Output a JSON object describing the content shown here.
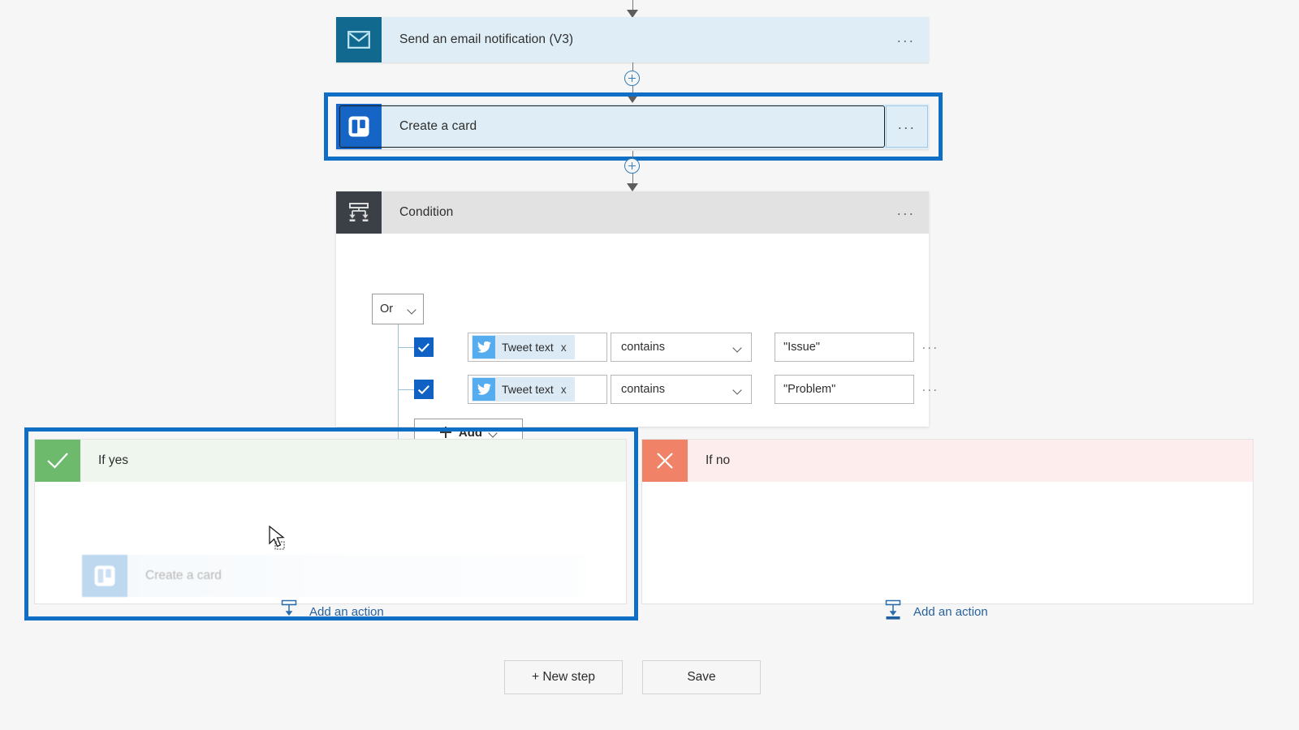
{
  "colors": {
    "canvas_bg": "#f6f6f6",
    "card_bg": "#dfeef6",
    "selection_blue": "#0f6fc5",
    "email_icon_bg": "#11698f",
    "trello_icon_bg": "#1565c6",
    "condition_icon_bg": "#3b3f46",
    "condition_header_bg": "#e2e2e2",
    "checkbox_blue": "#0f62c4",
    "twitter_blue": "#55acee",
    "yes_badge_green": "#6dba6d",
    "yes_header_bg": "#eef6ee",
    "no_badge_red": "#f08268",
    "no_header_bg": "#fdeeed",
    "link_blue": "#28629e",
    "tree_line": "#9cc4d6"
  },
  "steps": {
    "send_email": {
      "title": "Send an email notification (V3)",
      "icon": "envelope-icon",
      "menu": "..."
    },
    "create_card": {
      "title": "Create a card",
      "icon": "trello-icon",
      "menu": "...",
      "selected": true
    },
    "condition": {
      "title": "Condition",
      "icon": "condition-icon",
      "menu": "...",
      "logic_operator": "Or",
      "rows": [
        {
          "checked": true,
          "token_icon": "twitter-icon",
          "token_label": "Tweet text",
          "token_remove": "x",
          "operator": "contains",
          "value": "\"Issue\"",
          "menu": "..."
        },
        {
          "checked": true,
          "token_icon": "twitter-icon",
          "token_label": "Tweet text",
          "token_remove": "x",
          "operator": "contains",
          "value": "\"Problem\"",
          "menu": "..."
        }
      ],
      "add_button": "Add"
    }
  },
  "branches": {
    "yes": {
      "label": "If yes",
      "badge_icon": "checkmark-icon",
      "dragged_card": {
        "title": "Create a card",
        "icon": "trello-icon"
      },
      "add_action": "Add an action",
      "selected": true
    },
    "no": {
      "label": "If no",
      "badge_icon": "cross-icon",
      "add_action": "Add an action"
    }
  },
  "connectors": {
    "plus_label": "+"
  },
  "footer": {
    "new_step": "+ New step",
    "save": "Save"
  }
}
